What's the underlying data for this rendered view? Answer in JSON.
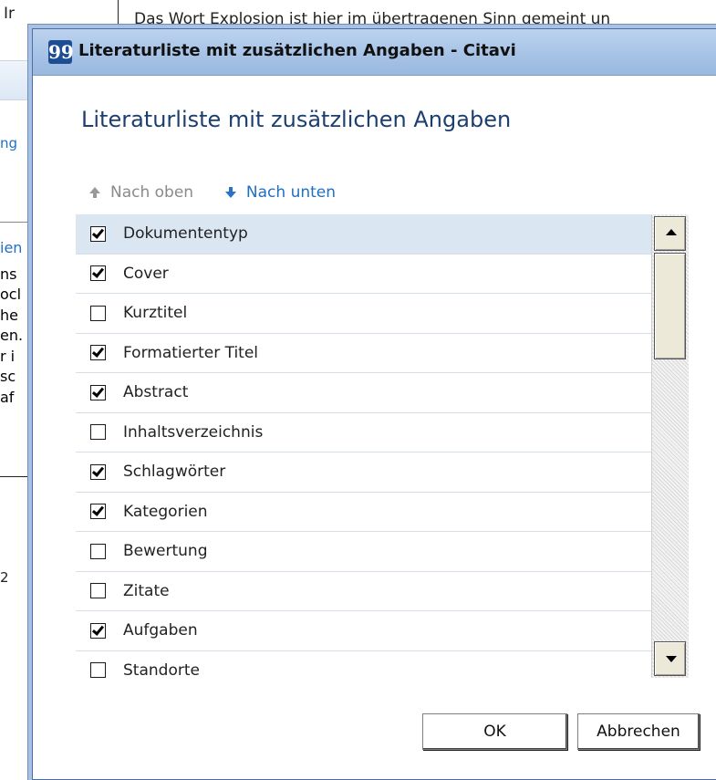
{
  "background": {
    "tab_text": "Ir",
    "link_text": "ng",
    "lines": [
      "ien",
      "ns",
      "ocl",
      "he",
      "en.",
      "r i",
      "sc",
      "af"
    ],
    "number": "2",
    "paragraph": "Das Wort Explosion ist hier im übertragenen Sinn gemeint un"
  },
  "dialog": {
    "title": "Literaturliste mit zusätzlichen Angaben - Citavi",
    "app_icon": "99",
    "heading": "Literaturliste mit zusätzlichen Angaben",
    "move_up_label": "Nach oben",
    "move_down_label": "Nach unten",
    "items": [
      {
        "label": "Dokumententyp",
        "checked": true,
        "selected": true
      },
      {
        "label": "Cover",
        "checked": true,
        "selected": false
      },
      {
        "label": "Kurztitel",
        "checked": false,
        "selected": false
      },
      {
        "label": "Formatierter Titel",
        "checked": true,
        "selected": false
      },
      {
        "label": "Abstract",
        "checked": true,
        "selected": false
      },
      {
        "label": "Inhaltsverzeichnis",
        "checked": false,
        "selected": false
      },
      {
        "label": "Schlagwörter",
        "checked": true,
        "selected": false
      },
      {
        "label": "Kategorien",
        "checked": true,
        "selected": false
      },
      {
        "label": "Bewertung",
        "checked": false,
        "selected": false
      },
      {
        "label": "Zitate",
        "checked": false,
        "selected": false
      },
      {
        "label": "Aufgaben",
        "checked": true,
        "selected": false
      },
      {
        "label": "Standorte",
        "checked": false,
        "selected": false
      }
    ],
    "ok_label": "OK",
    "cancel_label": "Abbrechen"
  },
  "colors": {
    "accent": "#1f6fc4",
    "heading": "#1c3f70",
    "selection": "#dbe6f3"
  }
}
